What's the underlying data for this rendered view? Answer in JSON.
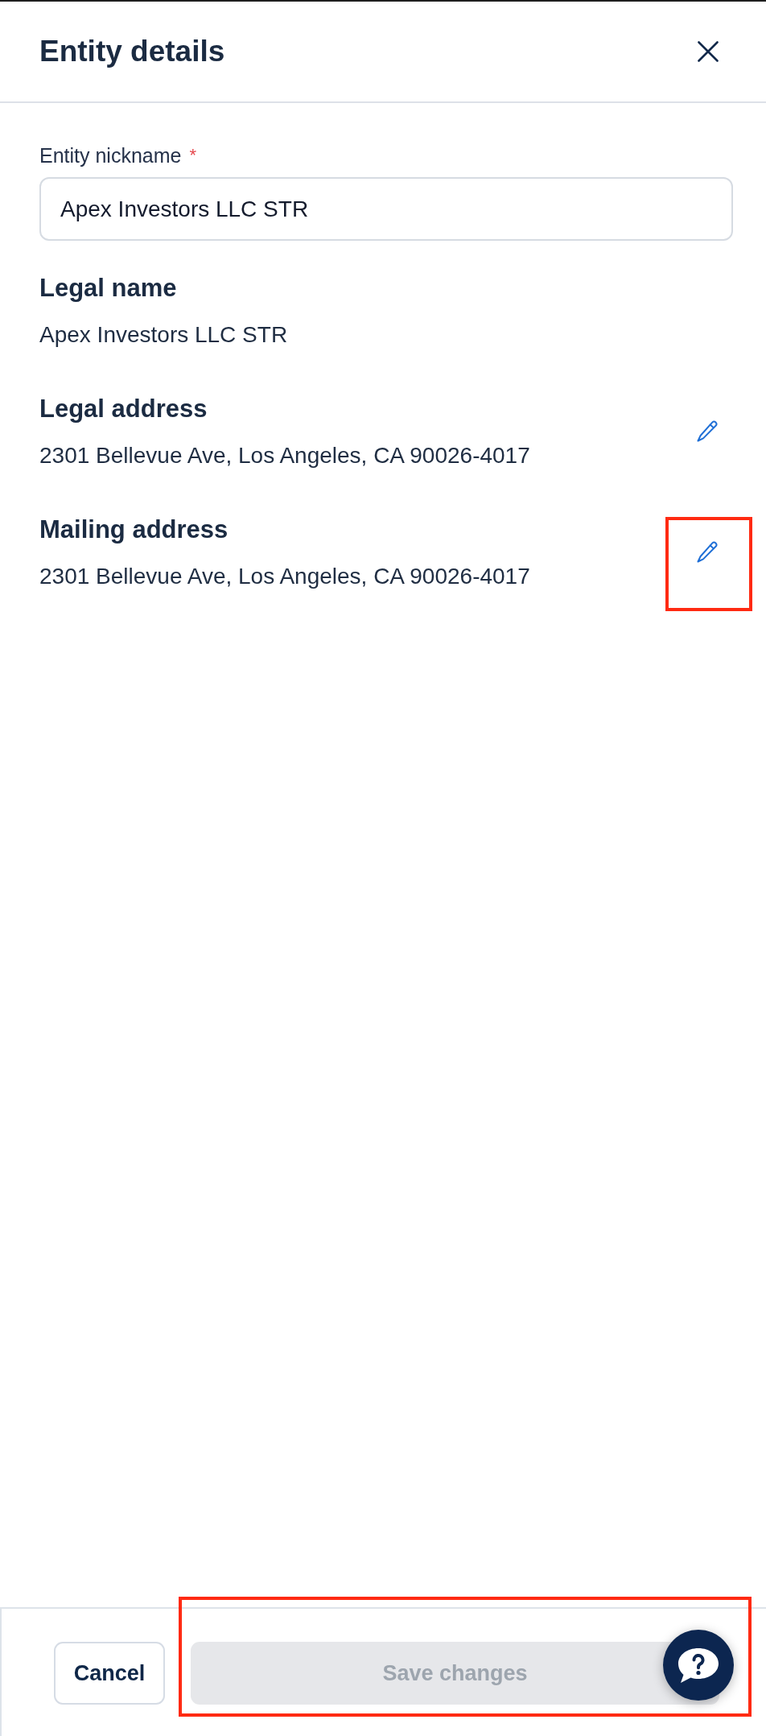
{
  "header": {
    "title": "Entity details"
  },
  "nickname_field": {
    "label": "Entity nickname",
    "required_mark": "*",
    "value": "Apex Investors LLC STR"
  },
  "sections": [
    {
      "kind": "text",
      "heading": "Legal name",
      "value": "Apex Investors LLC STR"
    },
    {
      "kind": "editable",
      "heading": "Legal address",
      "value": "2301 Bellevue Ave, Los Angeles, CA 90026-4017",
      "highlighted": false
    },
    {
      "kind": "editable",
      "heading": "Mailing address",
      "value": "2301 Bellevue Ave, Los Angeles, CA 90026-4017",
      "highlighted": true
    }
  ],
  "footer": {
    "highlighted": true,
    "buttons": [
      {
        "kind": "secondary",
        "label": "Cancel",
        "disabled": false
      },
      {
        "kind": "primary",
        "label": "Save changes",
        "disabled": true
      }
    ]
  }
}
